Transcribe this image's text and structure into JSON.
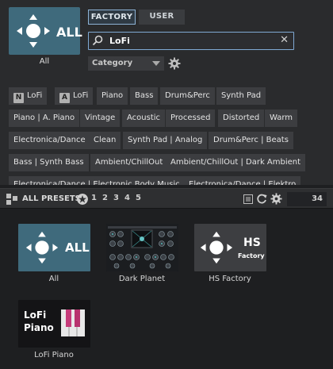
{
  "header": {
    "main_tile_label": "All",
    "main_tile_text": "ALL",
    "tabs": [
      {
        "label": "FACTORY",
        "active": true
      },
      {
        "label": "USER",
        "active": false
      }
    ],
    "search": {
      "value": "LoFi"
    },
    "category": {
      "label": "Category"
    }
  },
  "tags": [
    {
      "label": "LoFi",
      "badge": "N"
    },
    {
      "label": "LoFi",
      "badge": "A"
    },
    {
      "label": "Piano"
    },
    {
      "label": "Bass"
    },
    {
      "label": "Drum&Perc"
    },
    {
      "label": "Synth Pad"
    },
    {
      "label": "Piano | A. Piano"
    },
    {
      "label": "Vintage"
    },
    {
      "label": "Acoustic"
    },
    {
      "label": "Processed"
    },
    {
      "label": "Distorted"
    },
    {
      "label": "Warm"
    },
    {
      "label": "Electronica/Dance"
    },
    {
      "label": "Clean"
    },
    {
      "label": "Synth Pad | Analog"
    },
    {
      "label": "Drum&Perc | Beats"
    },
    {
      "label": "Bass | Synth Bass"
    },
    {
      "label": "Ambient/ChillOut"
    },
    {
      "label": "Ambient/ChillOut | Dark Ambient"
    },
    {
      "label": "Electronica/Dance | Electronic Body Music"
    },
    {
      "label": "Electronica/Dance | Elektro"
    }
  ],
  "toolbar": {
    "title": "ALL PRESETS",
    "ratings": [
      "1",
      "2",
      "3",
      "4",
      "5"
    ],
    "count": "34"
  },
  "presets": [
    {
      "label": "All",
      "tile_text": "ALL"
    },
    {
      "label": "Dark Planet"
    },
    {
      "label": "HS Factory",
      "tile_text": "HS",
      "tile_sub": "Factory"
    },
    {
      "label": "LoFi Piano",
      "tile_text_1": "LoFi",
      "tile_text_2": "Piano"
    }
  ],
  "colors": {
    "accent": "#7fa9d4",
    "tile_blue": "#3f6a7c",
    "tile_gray": "#3d3e41"
  }
}
